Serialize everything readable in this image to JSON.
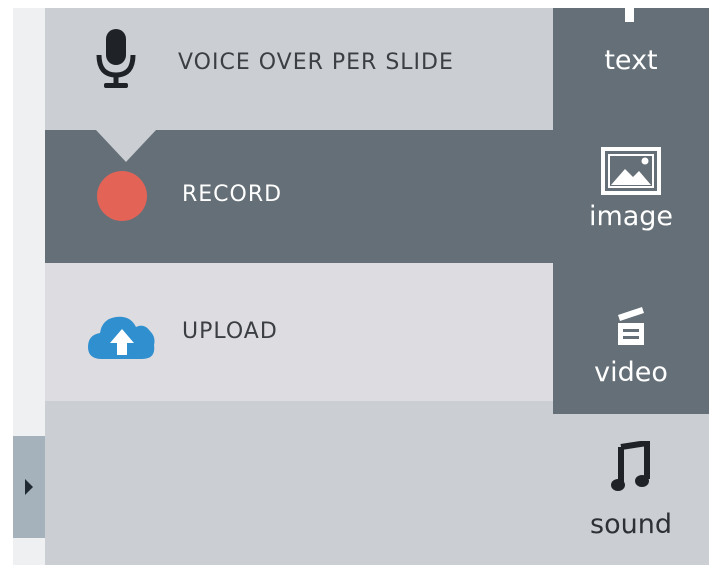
{
  "audio_panel": {
    "voice_over_label": "VOICE OVER PER SLIDE",
    "record_label": "RECORD",
    "upload_label": "UPLOAD"
  },
  "toolbar": {
    "items": [
      {
        "label": "text",
        "icon": "text-icon"
      },
      {
        "label": "image",
        "icon": "image-icon"
      },
      {
        "label": "video",
        "icon": "video-icon"
      },
      {
        "label": "sound",
        "icon": "music-note-icon"
      }
    ]
  },
  "colors": {
    "panel_bg": "#cbcfd4",
    "active_row_bg": "#646f77",
    "upload_row_bg": "#dcdce1",
    "toolbar_bg": "#646f77",
    "record_red": "#e46357",
    "cloud_blue": "#2f8fcf",
    "handle_bg": "#a6b2bb"
  }
}
